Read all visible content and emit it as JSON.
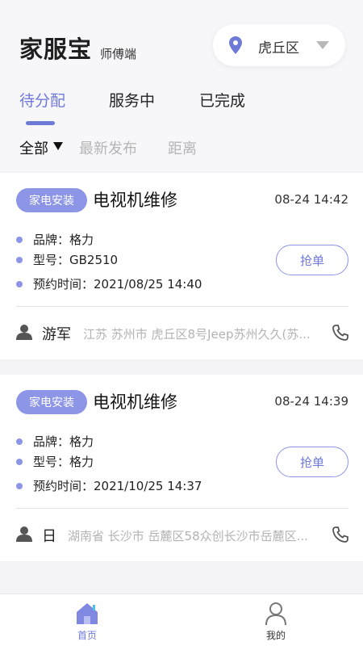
{
  "header": {
    "brand_title": "家服宝",
    "brand_subtitle": "师傅端",
    "location": "虎丘区"
  },
  "tabs": [
    {
      "label": "待分配",
      "active": true
    },
    {
      "label": "服务中",
      "active": false
    },
    {
      "label": "已完成",
      "active": false
    }
  ],
  "filters": [
    {
      "label": "全部",
      "active": true
    },
    {
      "label": "最新发布",
      "active": false
    },
    {
      "label": "距离",
      "active": false
    }
  ],
  "orders": [
    {
      "badge": "家电安装",
      "title": "电视机维修",
      "time": "08-24 14:42",
      "brand_line": "品牌：格力",
      "model_line": "型号：GB2510",
      "appointment_line": "预约时间：2021/08/25 14:40",
      "grab_label": "抢单",
      "customer": "游军",
      "address": "江苏 苏州市 虎丘区8号Jeep苏州久久(苏..."
    },
    {
      "badge": "家电安装",
      "title": "电视机维修",
      "time": "08-24 14:39",
      "brand_line": "品牌：格力",
      "model_line": "型号：格力",
      "appointment_line": "预约时间：2021/10/25 14:37",
      "grab_label": "抢单",
      "customer": "日",
      "address": "湖南省 长沙市 岳麓区58众创长沙市岳麓区..."
    }
  ],
  "bottom_nav": [
    {
      "label": "首页",
      "icon": "home-icon",
      "active": true
    },
    {
      "label": "我的",
      "icon": "user-icon",
      "active": false
    }
  ],
  "colors": {
    "accent": "#6f79d8",
    "badge": "#8d95e6",
    "muted": "#b3b3b3"
  }
}
